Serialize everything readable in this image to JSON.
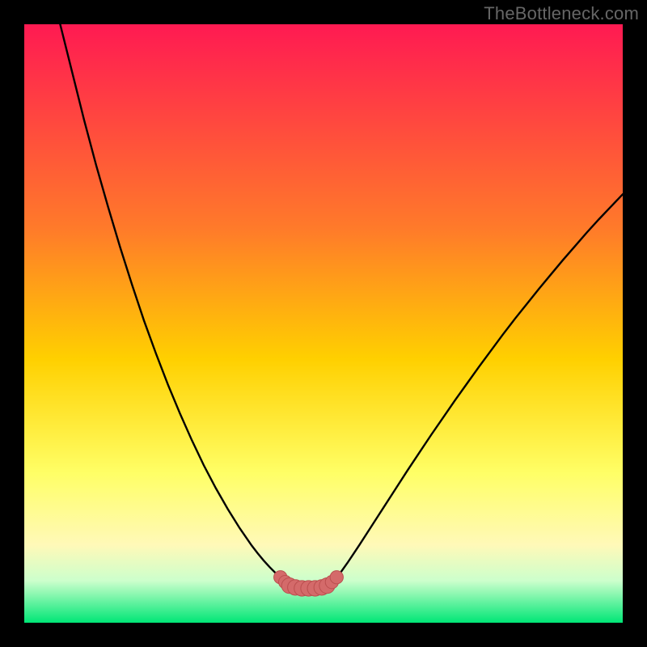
{
  "watermark": "TheBottleneck.com",
  "colors": {
    "gradient_top": "#ff1a52",
    "gradient_mid1": "#ff7a2a",
    "gradient_mid2": "#ffd000",
    "gradient_mid3": "#ffff66",
    "gradient_mid4": "#fff9b8",
    "gradient_bottom1": "#ccffcc",
    "gradient_bottom2": "#00e676",
    "curve_stroke": "#000000",
    "marker_fill": "#d46a6a",
    "marker_stroke": "#bb4f4f",
    "frame": "#000000"
  },
  "chart_data": {
    "type": "line",
    "title": "",
    "xlabel": "",
    "ylabel": "",
    "x_range": [
      0,
      100
    ],
    "y_range": [
      0,
      100
    ],
    "left_curve": [
      [
        6,
        100
      ],
      [
        8,
        92
      ],
      [
        10,
        84
      ],
      [
        12,
        76.5
      ],
      [
        14,
        69.5
      ],
      [
        16,
        62.8
      ],
      [
        18,
        56.5
      ],
      [
        20,
        50.5
      ],
      [
        22,
        45
      ],
      [
        24,
        39.8
      ],
      [
        26,
        35
      ],
      [
        28,
        30.5
      ],
      [
        30,
        26.3
      ],
      [
        32,
        22.5
      ],
      [
        34,
        19
      ],
      [
        36,
        15.8
      ],
      [
        38,
        12.9
      ],
      [
        39,
        11.6
      ],
      [
        40,
        10.4
      ],
      [
        41,
        9.3
      ],
      [
        42,
        8.3
      ],
      [
        42.8,
        7.6
      ]
    ],
    "right_curve": [
      [
        52.2,
        7.6
      ],
      [
        53,
        8.6
      ],
      [
        54,
        10
      ],
      [
        55,
        11.5
      ],
      [
        56,
        13
      ],
      [
        58,
        16.1
      ],
      [
        60,
        19.2
      ],
      [
        62,
        22.3
      ],
      [
        64,
        25.4
      ],
      [
        66,
        28.4
      ],
      [
        68,
        31.4
      ],
      [
        70,
        34.3
      ],
      [
        72,
        37.2
      ],
      [
        74,
        40
      ],
      [
        76,
        42.8
      ],
      [
        78,
        45.5
      ],
      [
        80,
        48.2
      ],
      [
        82,
        50.8
      ],
      [
        84,
        53.3
      ],
      [
        86,
        55.8
      ],
      [
        88,
        58.2
      ],
      [
        90,
        60.6
      ],
      [
        92,
        62.9
      ],
      [
        94,
        65.2
      ],
      [
        96,
        67.4
      ],
      [
        98,
        69.5
      ],
      [
        100,
        71.6
      ]
    ],
    "markers": [
      {
        "x": 42.8,
        "y": 7.6,
        "r": 1.1
      },
      {
        "x": 43.6,
        "y": 6.8,
        "r": 1.1
      },
      {
        "x": 44.3,
        "y": 6.2,
        "r": 1.3
      },
      {
        "x": 45.3,
        "y": 5.9,
        "r": 1.3
      },
      {
        "x": 46.4,
        "y": 5.75,
        "r": 1.3
      },
      {
        "x": 47.5,
        "y": 5.75,
        "r": 1.3
      },
      {
        "x": 48.6,
        "y": 5.75,
        "r": 1.3
      },
      {
        "x": 49.7,
        "y": 5.9,
        "r": 1.3
      },
      {
        "x": 50.6,
        "y": 6.2,
        "r": 1.3
      },
      {
        "x": 51.4,
        "y": 6.8,
        "r": 1.1
      },
      {
        "x": 52.2,
        "y": 7.6,
        "r": 1.1
      }
    ],
    "flat_segment": {
      "x1": 44.3,
      "y1": 6.1,
      "x2": 50.6,
      "y2": 6.1
    }
  }
}
